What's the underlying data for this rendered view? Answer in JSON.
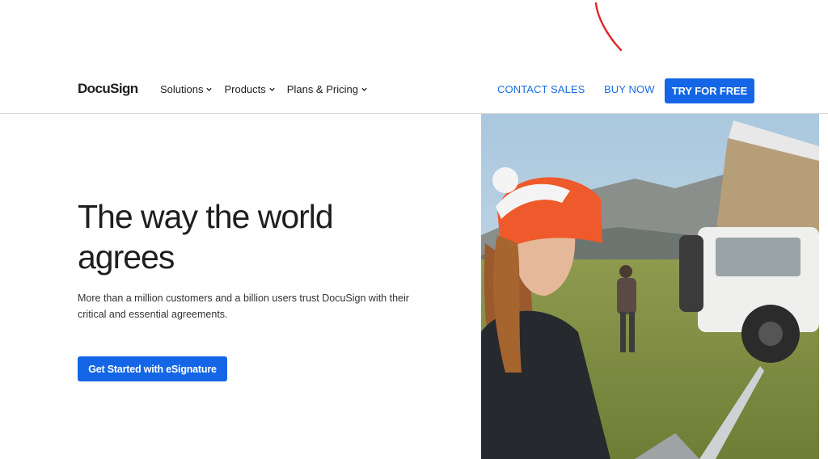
{
  "header": {
    "logo_text": "DocuSign",
    "nav": [
      {
        "label": "Solutions"
      },
      {
        "label": "Products"
      },
      {
        "label": "Plans & Pricing"
      }
    ],
    "contact_sales": "CONTACT SALES",
    "buy_now": "BUY NOW",
    "try_free": "TRY FOR FREE"
  },
  "hero": {
    "title": "The way the world agrees",
    "subtitle": "More than a million customers and a billion users trust DocuSign with their critical and essential agreements.",
    "cta_label": "Get Started with eSignature",
    "image_icon": "hero-photo-woman-laptop-outdoors"
  },
  "colors": {
    "accent": "#1466e6",
    "link": "#1a6ee6",
    "text": "#1e1e1e",
    "annotation": "#e0262a"
  }
}
